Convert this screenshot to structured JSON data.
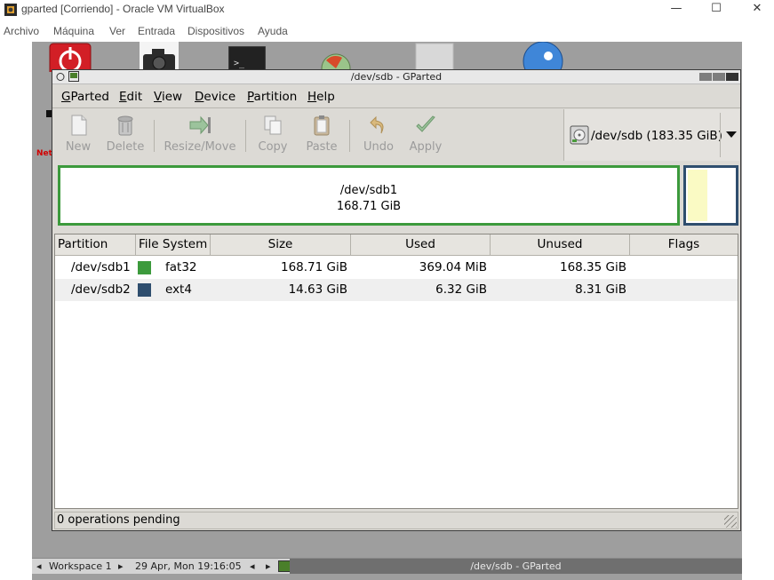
{
  "host": {
    "window_title": "gparted [Corriendo] - Oracle VM VirtualBox",
    "controls": {
      "minimize": "—",
      "maximize": "☐",
      "close": "✕"
    },
    "menu": [
      "Archivo",
      "Máquina",
      "Ver",
      "Entrada",
      "Dispositivos",
      "Ayuda"
    ]
  },
  "gparted": {
    "window_title": "/dev/sdb - GParted",
    "menu": [
      {
        "accel": "G",
        "rest": "Parted"
      },
      {
        "accel": "E",
        "rest": "dit"
      },
      {
        "accel": "V",
        "rest": "iew"
      },
      {
        "accel": "D",
        "rest": "evice"
      },
      {
        "accel": "P",
        "rest": "artition"
      },
      {
        "accel": "H",
        "rest": "elp"
      }
    ],
    "toolbar": {
      "new": "New",
      "delete": "Delete",
      "resize": "Resize/Move",
      "copy": "Copy",
      "paste": "Paste",
      "undo": "Undo",
      "apply": "Apply"
    },
    "device_selector": "/dev/sdb  (183.35 GiB)",
    "disk_map": {
      "part_name": "/dev/sdb1",
      "part_size": "168.71 GiB"
    },
    "columns": [
      "Partition",
      "File System",
      "Size",
      "Used",
      "Unused",
      "Flags"
    ],
    "partitions": [
      {
        "partition": "/dev/sdb1",
        "fs": "fat32",
        "fs_color": "#3c9a3c",
        "size": "168.71 GiB",
        "used": "369.04 MiB",
        "unused": "168.35 GiB",
        "flags": ""
      },
      {
        "partition": "/dev/sdb2",
        "fs": "ext4",
        "fs_color": "#2f4e6e",
        "size": "14.63 GiB",
        "used": "6.32 GiB",
        "unused": "8.31 GiB",
        "flags": ""
      }
    ],
    "status": "0 operations pending"
  },
  "guest_taskbar": {
    "workspace": "Workspace 1",
    "datetime": "29 Apr, Mon 19:16:05",
    "active_app": "/dev/sdb - GParted"
  },
  "colors": {
    "fat32": "#3c9a3c",
    "ext4": "#2f4e6e",
    "desktop": "#9e9e9e"
  }
}
